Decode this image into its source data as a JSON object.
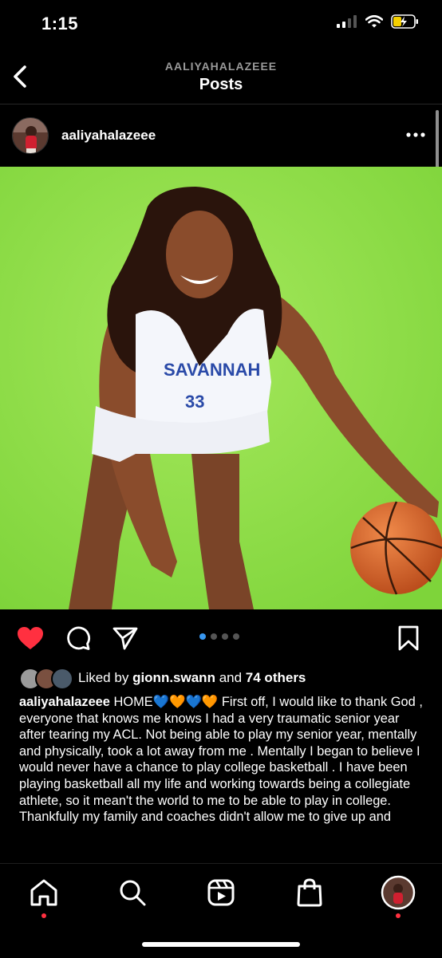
{
  "status": {
    "time": "1:15"
  },
  "header": {
    "account": "AALIYAHALAZEEE",
    "title": "Posts"
  },
  "post": {
    "username": "aaliyahalazeee",
    "image_description": "Basketball player in white Savannah State jersey number 33 posing with a basketball on a green backdrop",
    "jersey_text": "SAVANNAH",
    "jersey_number": "33",
    "carousel": {
      "count": 4,
      "active": 0
    }
  },
  "likes": {
    "prefix": "Liked by",
    "user": "gionn.swann",
    "middle": "and",
    "others": "74 others"
  },
  "caption": {
    "username": "aaliyahalazeee",
    "text": "HOME💙🧡💙🧡 First off, I would like to thank God , everyone that knows me knows I had a very traumatic senior year after tearing my ACL. Not being able to play my senior year, mentally and physically, took a lot away from me . Mentally I began to believe I would never have a chance to play college basketball . I have been playing basketball all my life and working towards being a collegiate athlete, so it mean't the world to me to be able to play in college. Thankfully my family and coaches didn't allow me to give up and"
  },
  "colors": {
    "like": "#ff3040",
    "carousel_active": "#3897f0",
    "backdrop": "#8fdc4a"
  }
}
